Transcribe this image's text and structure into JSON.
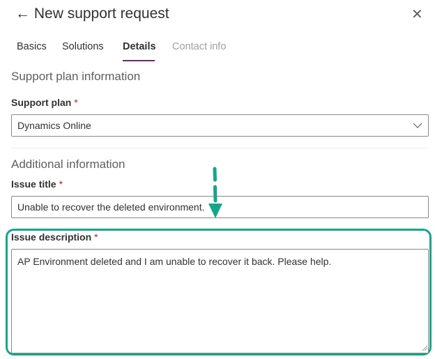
{
  "header": {
    "title": "New support request"
  },
  "tabs": [
    {
      "label": "Basics"
    },
    {
      "label": "Solutions"
    },
    {
      "label": "Details"
    },
    {
      "label": "Contact info"
    }
  ],
  "support_plan_section": {
    "heading": "Support plan information",
    "label": "Support plan",
    "required": "*",
    "value": "Dynamics Online"
  },
  "additional_section": {
    "heading": "Additional information",
    "issue_title": {
      "label": "Issue title",
      "required": "*",
      "value": "Unable to recover the deleted environment."
    },
    "issue_description": {
      "label": "Issue description",
      "required": "*",
      "value": "AP Environment deleted and I am unable to recover it back. Please help."
    }
  },
  "annotation": {
    "color": "#17a589"
  }
}
